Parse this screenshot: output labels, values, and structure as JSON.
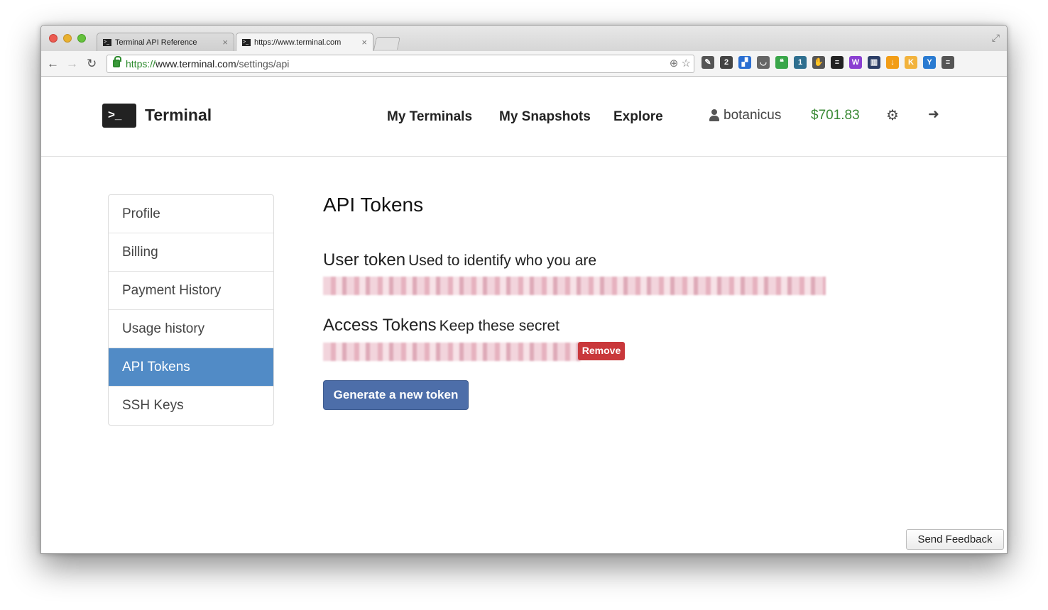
{
  "browser": {
    "tabs": [
      {
        "title": "Terminal API Reference",
        "active": false
      },
      {
        "title": "https://www.terminal.com",
        "active": true
      }
    ],
    "url": {
      "scheme": "https://",
      "host": "www.terminal.com",
      "path": "/settings/api"
    },
    "extensions": [
      {
        "name": "wrench-icon",
        "color": "#555555",
        "glyph": "✎"
      },
      {
        "name": "notes-icon",
        "color": "#444444",
        "glyph": "2"
      },
      {
        "name": "delicious-icon",
        "color": "#2a6ed1",
        "glyph": "▞"
      },
      {
        "name": "pocket-icon",
        "color": "#666666",
        "glyph": "◡"
      },
      {
        "name": "hangouts-icon",
        "color": "#3aa64a",
        "glyph": "❝"
      },
      {
        "name": "rss-icon",
        "color": "#2f6f8f",
        "glyph": "1"
      },
      {
        "name": "evernote-icon",
        "color": "#555555",
        "glyph": "✋"
      },
      {
        "name": "buffer-icon",
        "color": "#222222",
        "glyph": "≡"
      },
      {
        "name": "w-icon",
        "color": "#8a3fd1",
        "glyph": "W"
      },
      {
        "name": "books-icon",
        "color": "#2c3e66",
        "glyph": "▥"
      },
      {
        "name": "download-icon",
        "color": "#f29d16",
        "glyph": "↓"
      },
      {
        "name": "k-icon",
        "color": "#f2b33d",
        "glyph": "K"
      },
      {
        "name": "vpn-icon",
        "color": "#2a7bd1",
        "glyph": "Y"
      },
      {
        "name": "menu-icon",
        "color": "#555555",
        "glyph": "≡"
      }
    ]
  },
  "header": {
    "logo_glyph": ">_",
    "logo_text": "Terminal",
    "nav": [
      "My Terminals",
      "My Snapshots",
      "Explore"
    ],
    "username": "botanicus",
    "balance": "$701.83",
    "balance_color": "#3a8a35"
  },
  "sidebar": {
    "items": [
      {
        "label": "Profile",
        "active": false
      },
      {
        "label": "Billing",
        "active": false
      },
      {
        "label": "Payment History",
        "active": false
      },
      {
        "label": "Usage history",
        "active": false
      },
      {
        "label": "API Tokens",
        "active": true
      },
      {
        "label": "SSH Keys",
        "active": false
      }
    ],
    "active_color": "#518bc6"
  },
  "main": {
    "title": "API Tokens",
    "user_token": {
      "heading": "User token",
      "subheading": "Used to identify who you are"
    },
    "access_tokens": {
      "heading": "Access Tokens",
      "subheading": "Keep these secret",
      "remove_label": "Remove"
    },
    "generate_label": "Generate a new token"
  },
  "feedback_label": "Send Feedback"
}
